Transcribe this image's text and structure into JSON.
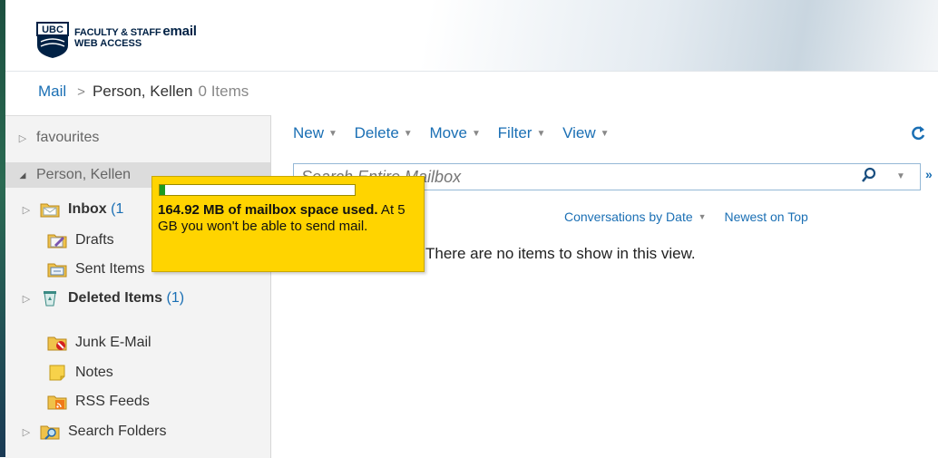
{
  "header": {
    "logo_short": "UBC",
    "logo_line1": "FACULTY & STAFF",
    "logo_line1_email": "email",
    "logo_line2": "WEB ACCESS"
  },
  "breadcrumb": {
    "root": "Mail",
    "separator": ">",
    "folder": "Person, Kellen",
    "count": "0 Items"
  },
  "nav": {
    "favourites": "favourites",
    "account": "Person, Kellen",
    "items": [
      {
        "label": "Inbox",
        "count": "(1",
        "bold": true,
        "expandable": true,
        "icon": "inbox-folder-icon"
      },
      {
        "label": "Drafts",
        "count": "",
        "bold": false,
        "expandable": false,
        "icon": "drafts-icon"
      },
      {
        "label": "Sent Items",
        "count": "",
        "bold": false,
        "expandable": false,
        "icon": "sent-items-icon"
      },
      {
        "label": "Deleted Items",
        "count": "(1)",
        "bold": true,
        "expandable": true,
        "icon": "deleted-items-icon"
      },
      {
        "label": "Junk E-Mail",
        "count": "",
        "bold": false,
        "expandable": false,
        "icon": "junk-email-icon"
      },
      {
        "label": "Notes",
        "count": "",
        "bold": false,
        "expandable": false,
        "icon": "notes-icon"
      },
      {
        "label": "RSS Feeds",
        "count": "",
        "bold": false,
        "expandable": false,
        "icon": "rss-feeds-icon"
      },
      {
        "label": "Search Folders",
        "count": "",
        "bold": false,
        "expandable": true,
        "icon": "search-folders-icon"
      }
    ]
  },
  "toolbar": {
    "new": "New",
    "delete": "Delete",
    "move": "Move",
    "filter": "Filter",
    "view": "View"
  },
  "search": {
    "placeholder": "Search Entire Mailbox"
  },
  "sort": {
    "arrange": "Conversations by Date",
    "order": "Newest on Top"
  },
  "empty_message": "There are no items to show in this view.",
  "quota_tooltip": {
    "used_fraction": 0.03,
    "bold_text": "164.92 MB of mailbox space used.",
    "rest_text": " At 5 GB you won't be able to send mail."
  },
  "colors": {
    "accent": "#1a6fb4",
    "tooltip_bg": "#ffd400",
    "quota_fill": "#1e9a1e",
    "brand_navy": "#002145"
  }
}
